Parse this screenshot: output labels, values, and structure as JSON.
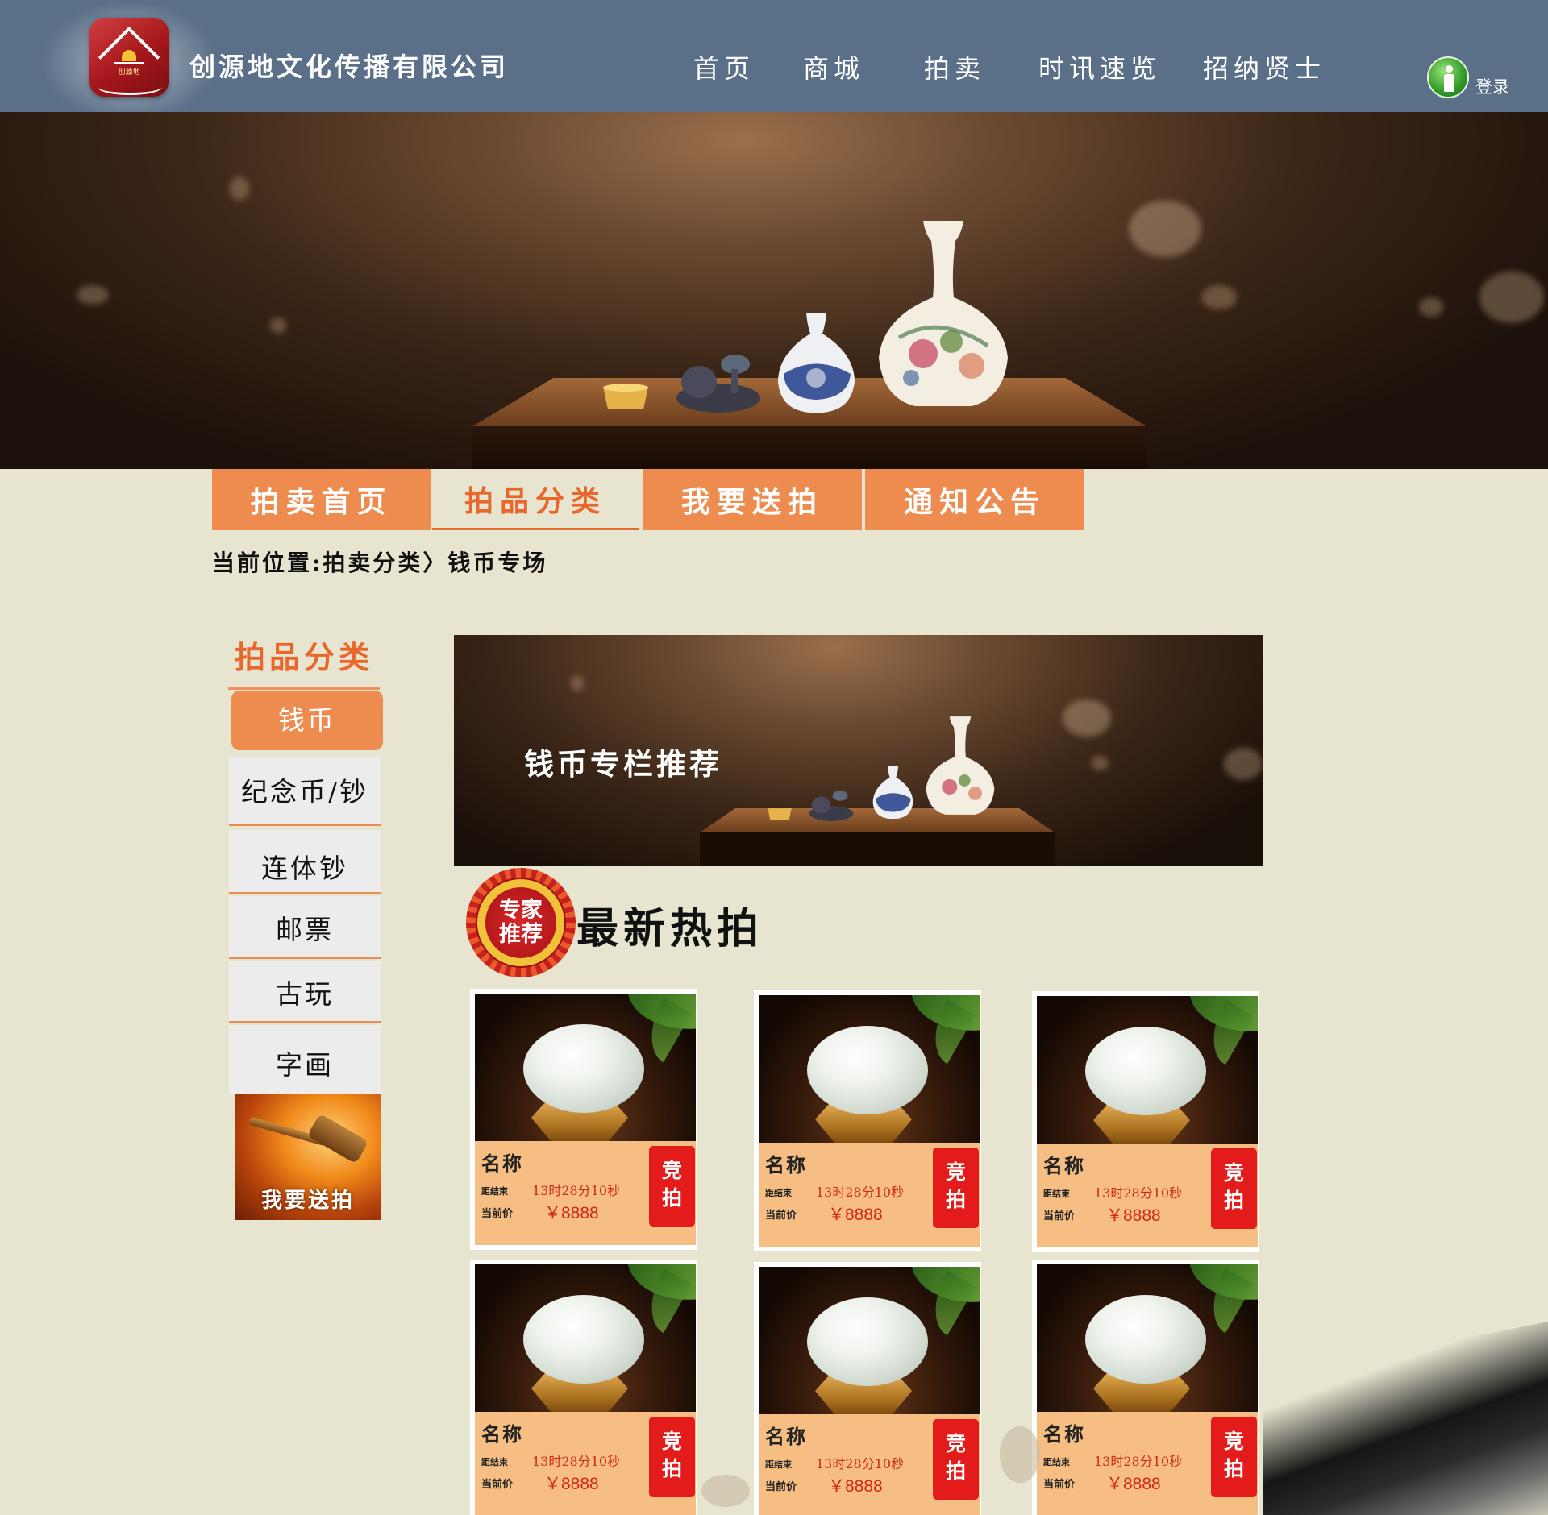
{
  "header": {
    "company_name": "创源地文化传播有限公司",
    "logo_text": "创源地",
    "nav": [
      "首页",
      "商城",
      "拍卖",
      "时讯速览",
      "招纳贤士"
    ],
    "login_label": "登录"
  },
  "tabs": [
    {
      "label": "拍卖首页",
      "active": false
    },
    {
      "label": "拍品分类",
      "active": true
    },
    {
      "label": "我要送拍",
      "active": false
    },
    {
      "label": "通知公告",
      "active": false
    }
  ],
  "breadcrumb": "当前位置:拍卖分类〉钱币专场",
  "sidebar": {
    "title": "拍品分类",
    "items": [
      {
        "label": "钱币",
        "active": true
      },
      {
        "label": "纪念币/钞",
        "active": false
      },
      {
        "label": "连体钞",
        "active": false
      },
      {
        "label": "邮票",
        "active": false
      },
      {
        "label": "古玩",
        "active": false
      },
      {
        "label": "字画",
        "active": false
      }
    ],
    "send_label": "我要送拍"
  },
  "main_banner_title": "钱币专栏推荐",
  "seal": {
    "line1": "专家",
    "line2": "推荐"
  },
  "section_title": "最新热拍",
  "products": [
    {
      "name": "名称",
      "end_label": "距结束",
      "time": "13时28分10秒",
      "price_label": "当前价",
      "price": "￥8888",
      "bid_line1": "竞",
      "bid_line2": "拍"
    },
    {
      "name": "名称",
      "end_label": "距结束",
      "time": "13时28分10秒",
      "price_label": "当前价",
      "price": "￥8888",
      "bid_line1": "竞",
      "bid_line2": "拍"
    },
    {
      "name": "名称",
      "end_label": "距结束",
      "time": "13时28分10秒",
      "price_label": "当前价",
      "price": "￥8888",
      "bid_line1": "竞",
      "bid_line2": "拍"
    },
    {
      "name": "名称",
      "end_label": "距结束",
      "time": "13时28分10秒",
      "price_label": "当前价",
      "price": "￥8888",
      "bid_line1": "竞",
      "bid_line2": "拍"
    },
    {
      "name": "名称",
      "end_label": "距结束",
      "time": "13时28分10秒",
      "price_label": "当前价",
      "price": "￥8888",
      "bid_line1": "竞",
      "bid_line2": "拍"
    },
    {
      "name": "名称",
      "end_label": "距结束",
      "time": "13时28分10秒",
      "price_label": "当前价",
      "price": "￥8888",
      "bid_line1": "竞",
      "bid_line2": "拍"
    }
  ],
  "colors": {
    "header_bg": "#5a7088",
    "page_bg": "#e7e4cf",
    "accent_orange": "#ee8b4f",
    "active_text": "#e8672d",
    "bid_red": "#e31b1b",
    "price_red": "#d02a18",
    "card_info_bg": "#f6be82"
  }
}
